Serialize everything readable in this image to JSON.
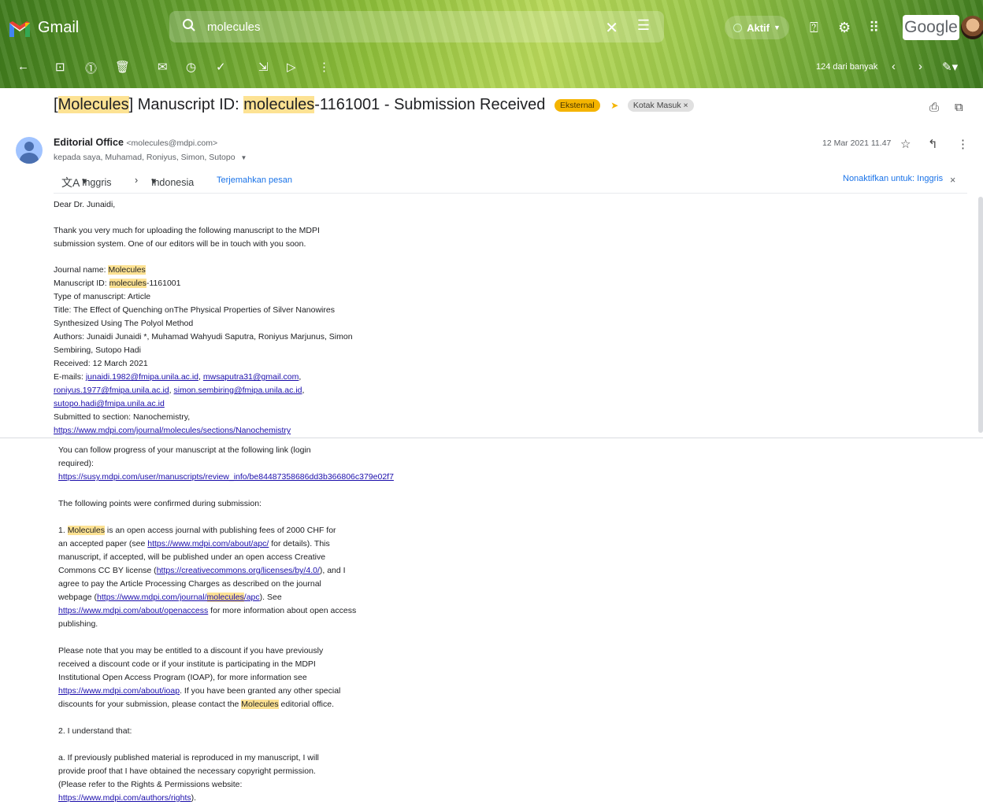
{
  "app": {
    "name": "Gmail"
  },
  "search": {
    "value": "molecules"
  },
  "status": {
    "label": "Aktif"
  },
  "account": {
    "brand": "Google"
  },
  "toolbar": {
    "count": "124 dari banyak"
  },
  "subject": {
    "pre": "[",
    "hl1": "Molecules",
    "mid1": "] Manuscript ID: ",
    "hl2": "molecules",
    "post": "-1161001 - Submission Received",
    "badge_external": "Eksternal",
    "badge_inbox": "Kotak Masuk ×"
  },
  "sender": {
    "name": "Editorial Office",
    "email": "<molecules@mdpi.com>",
    "recipients": "kepada saya, Muhamad, Roniyus, Simon, Sutopo",
    "date": "12 Mar 2021 11.47"
  },
  "translate": {
    "from": "Inggris",
    "to": "Indonesia",
    "action": "Terjemahkan pesan",
    "disable": "Nonaktifkan untuk: Inggris"
  },
  "body": {
    "greeting": "Dear Dr. Junaidi,",
    "p1a": "Thank you very much for uploading the following manuscript to the MDPI",
    "p1b": "submission system. One of our editors will be in touch with you soon.",
    "journal_label": "Journal name: ",
    "journal_value": "Molecules",
    "msid_label": "Manuscript ID: ",
    "msid_hl": "molecules",
    "msid_rest": "-1161001",
    "type": "Type of manuscript: Article",
    "title1": "Title: The Effect of Quenching onThe Physical Properties of Silver Nanowires",
    "title2": "Synthesized Using The Polyol Method",
    "authors1": "Authors: Junaidi Junaidi *, Muhamad Wahyudi Saputra, Roniyus Marjunus, Simon",
    "authors2": "Sembiring, Sutopo Hadi",
    "received": "Received: 12 March 2021",
    "emails_label": "E-mails: ",
    "email1": "junaidi.1982@fmipa.unila.ac.id",
    "email2": "mwsaputra31@gmail.com",
    "email3": "roniyus.1977@fmipa.unila.ac.id",
    "email4": "simon.sembiring@fmipa.unila.ac.id",
    "email5": "sutopo.hadi@fmipa.unila.ac.id",
    "section": "Submitted to section: Nanochemistry,",
    "section_link": "https://www.mdpi.com/journal/molecules/sections/Nanochemistry",
    "follow1": "You can follow progress of your manuscript at the following link (login",
    "follow2": "required):",
    "follow_link": "https://susy.mdpi.com/user/manuscripts/review_info/be84487358686dd3b366806c379e02f7",
    "confirmed": "The following points were confirmed during submission:",
    "pt1_pre": "1. ",
    "pt1_hl": "Molecules",
    "pt1_a": " is an open access journal with publishing fees of 2000 CHF for",
    "pt1_b_pre": "an accepted paper (see ",
    "pt1_b_link": "https://www.mdpi.com/about/apc/",
    "pt1_b_post": " for details). This",
    "pt1_c": "manuscript, if accepted, will be published under an open access Creative",
    "pt1_d_pre": "Commons CC BY license (",
    "pt1_d_link": "https://creativecommons.org/licenses/by/4.0/",
    "pt1_d_post": "), and I",
    "pt1_e": "agree to pay the Article Processing Charges as described on the journal",
    "pt1_f_pre": "webpage (",
    "pt1_f_link1": "https://www.mdpi.com/journal/",
    "pt1_f_hl": "molecules",
    "pt1_f_link2": "/apc",
    "pt1_f_post": "). See",
    "pt1_g_link": "https://www.mdpi.com/about/openaccess",
    "pt1_g_post": " for more information about open access",
    "pt1_h": "publishing.",
    "disc1": "Please note that you may be entitled to a discount if you have previously",
    "disc2": "received a discount code or if your institute is participating in the MDPI",
    "disc3": "Institutional Open Access Program (IOAP), for more information see",
    "disc4_link": "https://www.mdpi.com/about/ioap",
    "disc4_post": ". If you have been granted any other special",
    "disc5_pre": "discounts for your submission, please contact the ",
    "disc5_hl": "Molecules",
    "disc5_post": " editorial office.",
    "pt2": "2. I understand that:",
    "a1": "a. If previously published material is reproduced in my manuscript, I will",
    "a2": "provide proof that I have obtained the necessary copyright permission.",
    "a3": "(Please refer to the Rights & Permissions website:",
    "a4_link": "https://www.mdpi.com/authors/rights",
    "a4_post": ")."
  }
}
